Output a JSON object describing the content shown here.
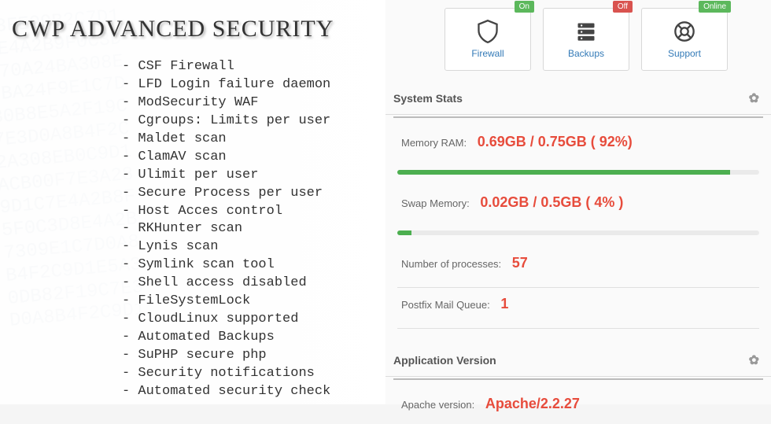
{
  "heading": "CWP ADVANCED SECURITY",
  "features": [
    "CSF Firewall",
    "LFD Login failure daemon",
    "ModSecurity WAF",
    "Cgroups: Limits per user",
    "Maldet scan",
    "ClamAV scan",
    "Ulimit per user",
    "Secure Process per user",
    "Host Acces control",
    "RKHunter scan",
    "Lynis scan",
    "Symlink scan tool",
    "Shell access disabled",
    "FileSystemLock",
    "CloudLinux supported",
    "Automated Backups",
    "SuPHP secure php",
    "Security notifications",
    "Automated security check"
  ],
  "tiles": [
    {
      "label": "Firewall",
      "badge": "On",
      "badge_class": "badge-on"
    },
    {
      "label": "Backups",
      "badge": "Off",
      "badge_class": "badge-off"
    },
    {
      "label": "Support",
      "badge": "Online",
      "badge_class": "badge-online"
    }
  ],
  "sections": {
    "stats_title": "System Stats",
    "app_title": "Application Version"
  },
  "stats": {
    "ram_label": "Memory RAM:",
    "ram_value": "0.69GB / 0.75GB ( 92%)",
    "ram_pct": 92,
    "swap_label": "Swap Memory:",
    "swap_value": "0.02GB / 0.5GB ( 4% )",
    "swap_pct": 4,
    "proc_label": "Number of processes:",
    "proc_value": "57",
    "mail_label": "Postfix Mail Queue:",
    "mail_value": "1"
  },
  "app": {
    "apache_label": "Apache version:",
    "apache_value": "Apache/2.2.27"
  }
}
